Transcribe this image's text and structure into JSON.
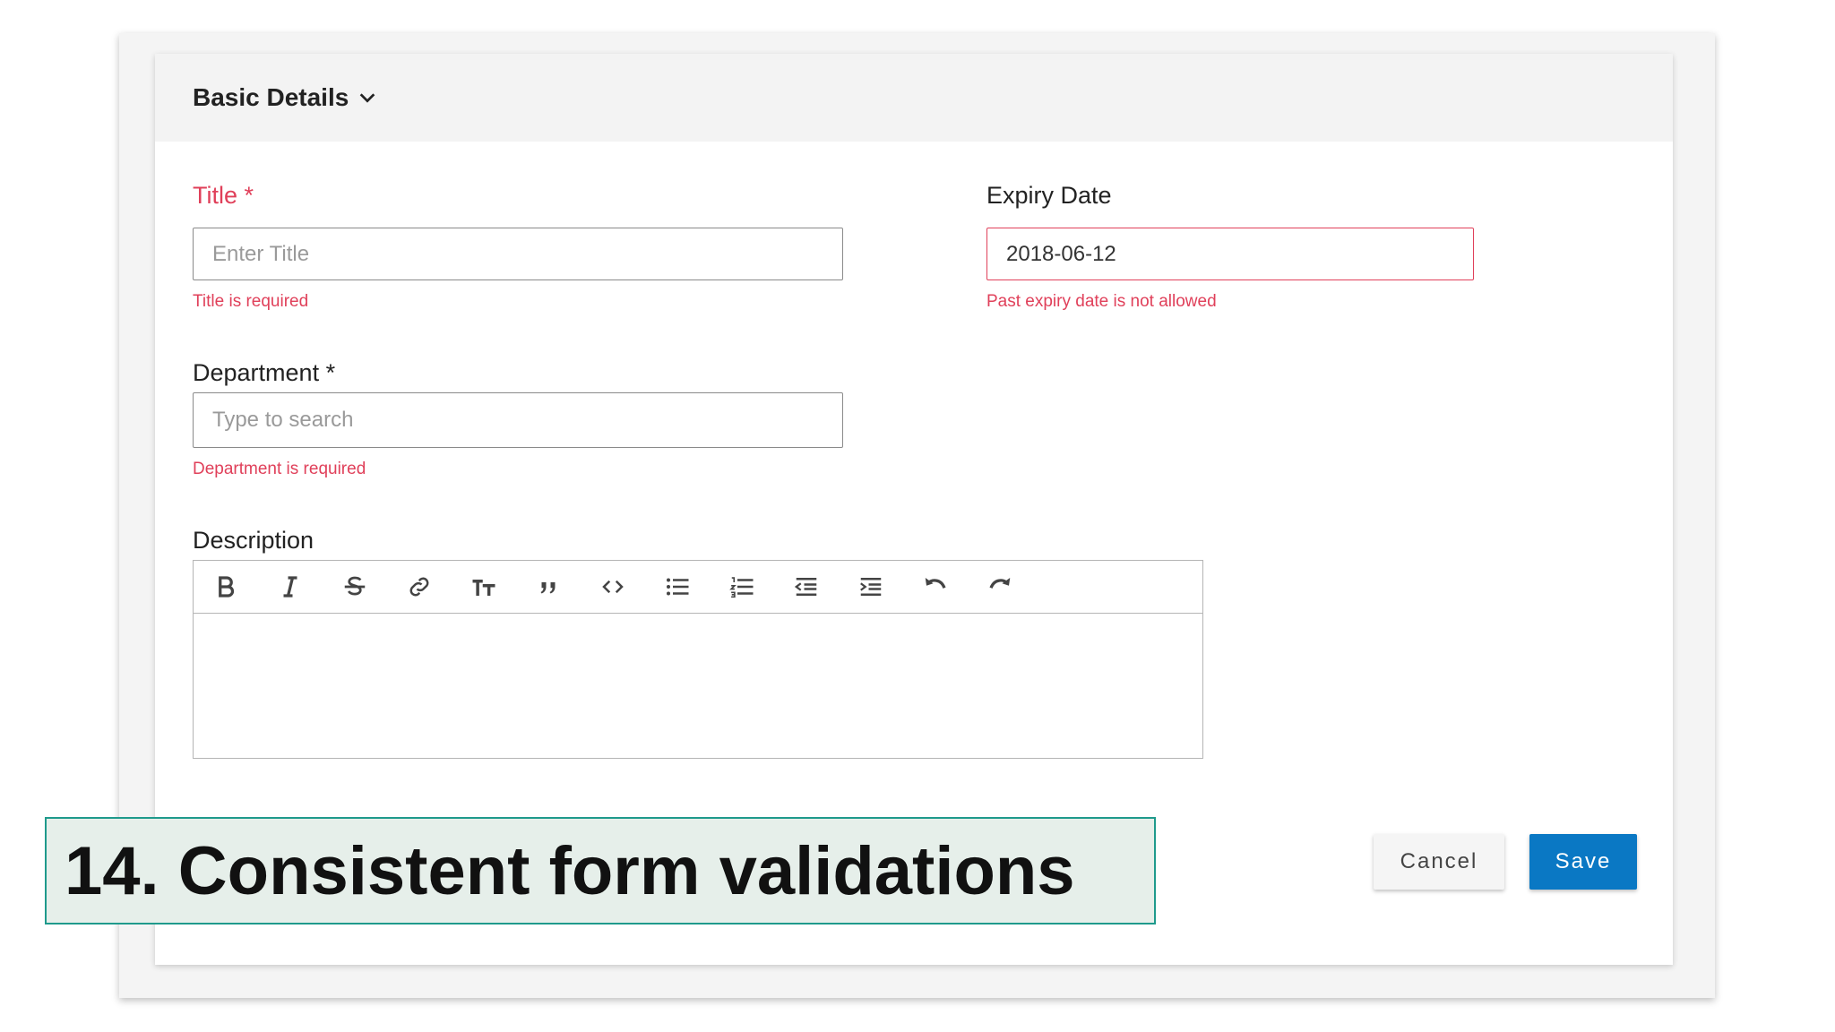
{
  "panel": {
    "title": "Basic Details"
  },
  "form": {
    "title": {
      "label": "Title *",
      "placeholder": "Enter Title",
      "error": "Title is required"
    },
    "expiry": {
      "label": "Expiry Date",
      "value": "2018-06-12",
      "error": "Past expiry date is not allowed"
    },
    "department": {
      "label": "Department *",
      "placeholder": "Type to search",
      "error": "Department is required"
    },
    "description": {
      "label": "Description"
    }
  },
  "toolbar_icons": [
    "bold-icon",
    "italic-icon",
    "strikethrough-icon",
    "link-icon",
    "text-size-icon",
    "quote-icon",
    "code-icon",
    "bullet-list-icon",
    "numbered-list-icon",
    "outdent-icon",
    "indent-icon",
    "undo-icon",
    "redo-icon"
  ],
  "buttons": {
    "cancel": "Cancel",
    "save": "Save"
  },
  "caption": "14. Consistent form validations",
  "colors": {
    "error": "#e0405a",
    "primary": "#0a78c4",
    "caption_border": "#1f9a8c"
  }
}
